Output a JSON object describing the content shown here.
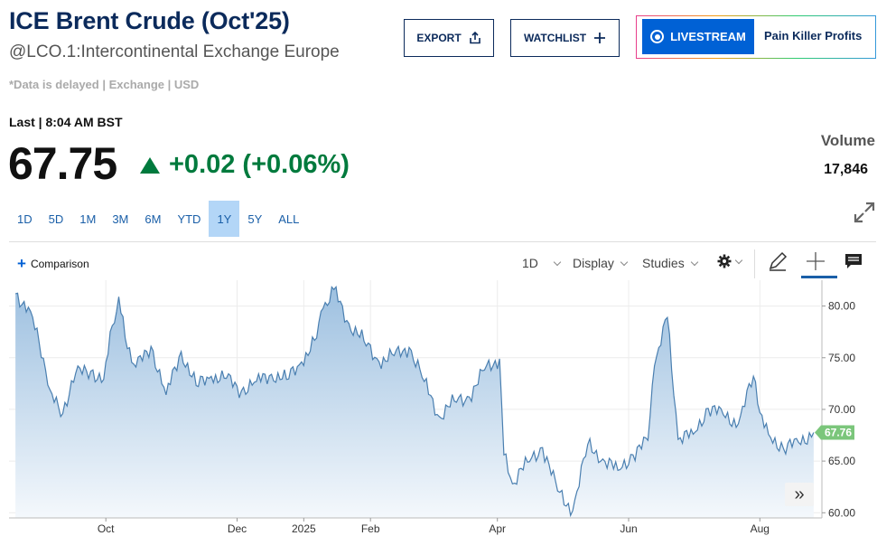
{
  "header": {
    "title": "ICE Brent Crude (Oct'25)",
    "symbol": "@LCO.1:Intercontinental Exchange Europe",
    "delayed_note": "*Data is delayed | Exchange | USD"
  },
  "actions": {
    "export_label": "EXPORT",
    "watchlist_label": "WATCHLIST",
    "livestream_label": "LIVESTREAM",
    "livestream_show": "Pain Killer Profits"
  },
  "quote": {
    "last_label": "Last | 8:04 AM BST",
    "price": "67.75",
    "change": "+0.02 (+0.06%)",
    "volume_label": "Volume",
    "volume": "17,846",
    "change_color": "#007a3d"
  },
  "ranges": [
    {
      "label": "1D",
      "active": false
    },
    {
      "label": "5D",
      "active": false
    },
    {
      "label": "1M",
      "active": false
    },
    {
      "label": "3M",
      "active": false
    },
    {
      "label": "6M",
      "active": false
    },
    {
      "label": "YTD",
      "active": false
    },
    {
      "label": "1Y",
      "active": true
    },
    {
      "label": "5Y",
      "active": false
    },
    {
      "label": "ALL",
      "active": false
    }
  ],
  "toolbar": {
    "comparison_label": "Comparison",
    "interval_label": "1D",
    "display_label": "Display",
    "studies_label": "Studies",
    "icons": [
      "gear-icon",
      "pencil-icon",
      "crosshair-icon",
      "comment-icon",
      "expand-icon",
      "fast-forward-icon"
    ]
  },
  "chart_data": {
    "type": "area",
    "xticks": [
      "Oct",
      "Dec",
      "2025",
      "Feb",
      "Apr",
      "Jun",
      "Aug"
    ],
    "yticks": [
      "80.00",
      "75.00",
      "70.00",
      "65.00",
      "60.00"
    ],
    "ylim": [
      59.5,
      82.5
    ],
    "last_value_label": "67.76",
    "x": [
      "2024-08-20",
      "2024-08-27",
      "2024-09-03",
      "2024-09-06",
      "2024-09-10",
      "2024-09-17",
      "2024-09-24",
      "2024-09-30",
      "2024-10-04",
      "2024-10-07",
      "2024-10-10",
      "2024-10-15",
      "2024-10-22",
      "2024-10-29",
      "2024-11-05",
      "2024-11-12",
      "2024-11-19",
      "2024-11-26",
      "2024-12-03",
      "2024-12-10",
      "2024-12-17",
      "2024-12-24",
      "2024-12-31",
      "2025-01-07",
      "2025-01-10",
      "2025-01-15",
      "2025-01-22",
      "2025-01-29",
      "2025-02-05",
      "2025-02-12",
      "2025-02-19",
      "2025-02-26",
      "2025-03-05",
      "2025-03-12",
      "2025-03-19",
      "2025-03-26",
      "2025-04-02",
      "2025-04-04",
      "2025-04-08",
      "2025-04-15",
      "2025-04-22",
      "2025-04-29",
      "2025-05-06",
      "2025-05-13",
      "2025-05-20",
      "2025-05-27",
      "2025-06-03",
      "2025-06-10",
      "2025-06-13",
      "2025-06-19",
      "2025-06-24",
      "2025-07-01",
      "2025-07-08",
      "2025-07-15",
      "2025-07-22",
      "2025-07-29",
      "2025-08-01",
      "2025-08-05",
      "2025-08-12",
      "2025-08-19",
      "2025-08-26"
    ],
    "values": [
      81.2,
      79.5,
      73.8,
      71.5,
      69.3,
      73.5,
      73.7,
      72.9,
      78.1,
      80.9,
      76.9,
      74.1,
      76.1,
      71.4,
      75.6,
      72.3,
      73.2,
      73.0,
      71.8,
      72.7,
      73.4,
      72.9,
      74.6,
      76.9,
      79.8,
      81.6,
      78.3,
      76.6,
      74.6,
      75.2,
      76.0,
      72.7,
      69.3,
      70.8,
      71.2,
      73.8,
      74.9,
      65.6,
      62.8,
      64.9,
      66.3,
      62.1,
      60.2,
      66.6,
      65.2,
      64.1,
      65.6,
      67.0,
      74.2,
      78.9,
      67.1,
      67.6,
      70.1,
      69.5,
      68.6,
      73.2,
      69.7,
      67.6,
      66.2,
      66.8,
      67.76
    ]
  },
  "colors": {
    "line": "#4a7fb0",
    "fill_top": "#9dc0e0",
    "fill_bottom": "#f4f8fc",
    "last_badge": "#7bc67b",
    "range_active": "#b3d6f7",
    "brand": "#0b2a5b",
    "livestream": "#0061d5"
  }
}
